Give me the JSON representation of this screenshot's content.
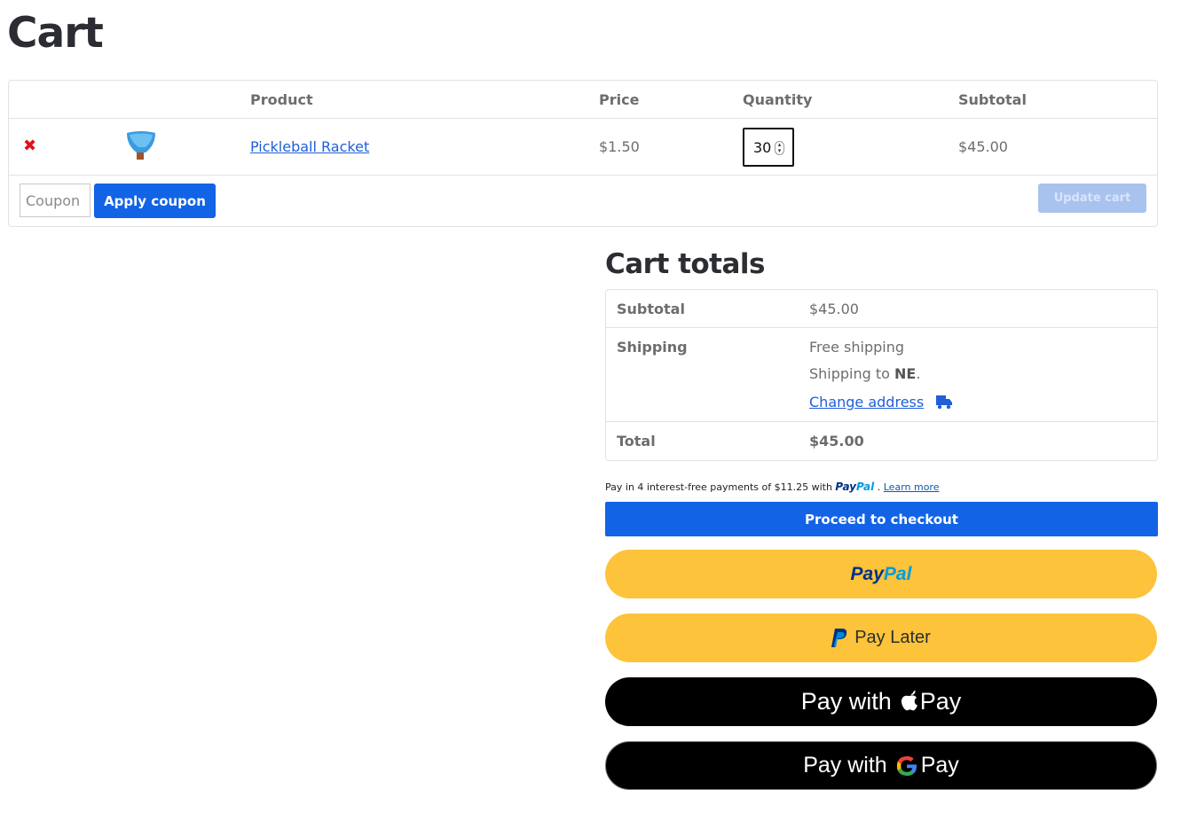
{
  "page": {
    "title": "Cart"
  },
  "cart_table": {
    "headers": {
      "product": "Product",
      "price": "Price",
      "quantity": "Quantity",
      "subtotal": "Subtotal"
    },
    "items": [
      {
        "remove_icon": "✖",
        "thumbnail_icon": "pickleball-racket-thumbnail",
        "product_name": "Pickleball Racket",
        "price": "$1.50",
        "quantity": "30",
        "subtotal": "$45.00"
      }
    ],
    "coupon": {
      "placeholder": "Coupon",
      "apply_label": "Apply coupon"
    },
    "update_label": "Update cart"
  },
  "cart_totals": {
    "title": "Cart totals",
    "subtotal_label": "Subtotal",
    "subtotal_value": "$45.00",
    "shipping_label": "Shipping",
    "shipping_method": "Free shipping",
    "shipping_to_prefix": "Shipping to ",
    "shipping_to_region": "NE",
    "shipping_to_suffix": ".",
    "change_address_label": "Change address",
    "total_label": "Total",
    "total_value": "$45.00"
  },
  "paypal_message": {
    "prefix": "Pay in 4 interest-free payments of $11.25 with",
    "brand_pay": "Pay",
    "brand_pal": "Pal",
    "separator": ".",
    "learn_more": "Learn more"
  },
  "checkout": {
    "label": "Proceed to checkout"
  },
  "payment_buttons": {
    "paypal_pay": "Pay",
    "paypal_pal": "Pal",
    "pay_later": "Pay Later",
    "apple_pay_prefix": "Pay with",
    "apple_pay_suffix": "Pay",
    "google_pay_prefix": "Pay with",
    "google_pay_suffix": "Pay"
  },
  "colors": {
    "primary_blue": "#1263e5",
    "link_blue": "#1f5fd8",
    "paypal_yellow": "#fdc33a",
    "paypal_navy": "#003087",
    "paypal_light_blue": "#009cde",
    "remove_red": "#e2101a"
  }
}
